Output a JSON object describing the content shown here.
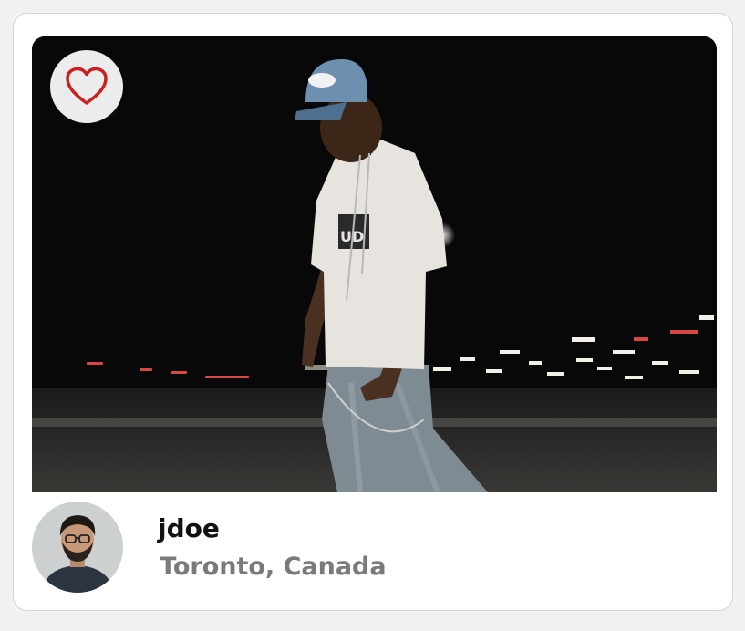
{
  "post": {
    "photo_description_icon": "photo-street-night",
    "favorite_icon": "heart-outline-icon",
    "favorite_color": "#cc1f1f"
  },
  "user": {
    "username": "jdoe",
    "location": "Toronto, Canada"
  },
  "colors": {
    "page_background": "#f1f1f1",
    "card_background": "#ffffff",
    "username_color": "#111111",
    "location_color": "#7a7a7a"
  }
}
